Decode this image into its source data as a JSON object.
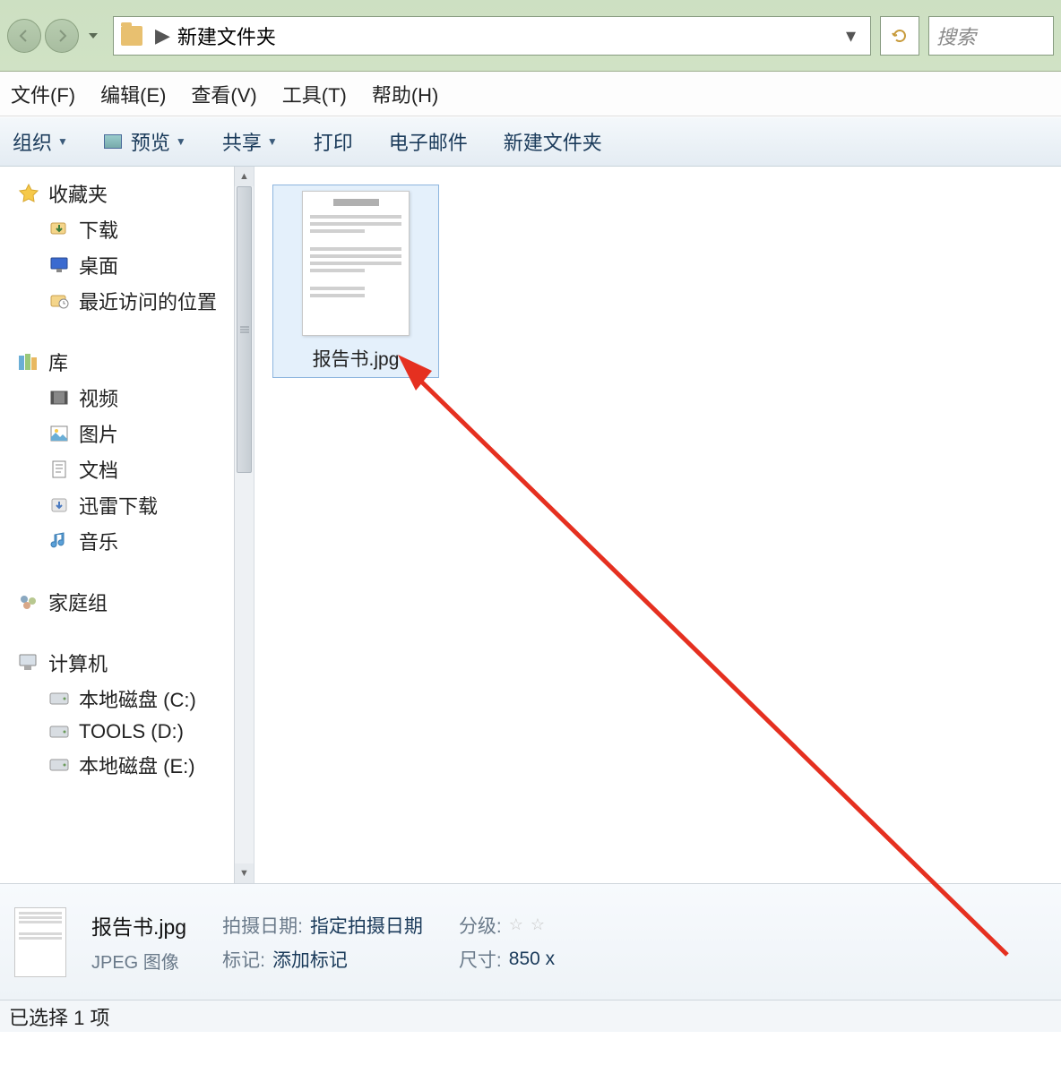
{
  "nav": {
    "breadcrumb_root": "新建文件夹",
    "search_placeholder": "搜索"
  },
  "menu": {
    "file": "文件(F)",
    "edit": "编辑(E)",
    "view": "查看(V)",
    "tools": "工具(T)",
    "help": "帮助(H)"
  },
  "toolbar": {
    "organize": "组织",
    "preview": "预览",
    "share": "共享",
    "print": "打印",
    "email": "电子邮件",
    "newfolder": "新建文件夹"
  },
  "sidebar": {
    "favorites": "收藏夹",
    "downloads": "下载",
    "desktop": "桌面",
    "recent": "最近访问的位置",
    "libraries": "库",
    "videos": "视频",
    "pictures": "图片",
    "documents": "文档",
    "xunlei": "迅雷下载",
    "music": "音乐",
    "homegroup": "家庭组",
    "computer": "计算机",
    "disk_c": "本地磁盘 (C:)",
    "disk_d": "TOOLS (D:)",
    "disk_e": "本地磁盘 (E:)"
  },
  "file": {
    "name": "报告书.jpg"
  },
  "details": {
    "filename": "报告书.jpg",
    "filetype": "JPEG 图像",
    "date_label": "拍摄日期:",
    "date_val": "指定拍摄日期",
    "tag_label": "标记:",
    "tag_val": "添加标记",
    "rating_label": "分级:",
    "size_label": "尺寸:",
    "size_val": "850 x"
  },
  "status": {
    "text": "已选择 1 项"
  }
}
